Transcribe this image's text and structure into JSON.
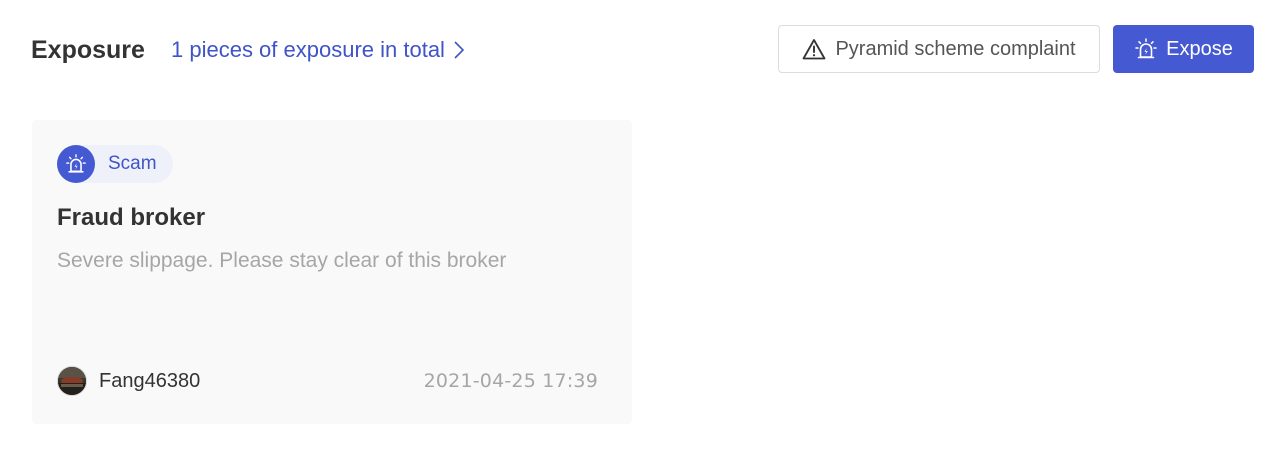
{
  "header": {
    "title": "Exposure",
    "total_link": "1 pieces of exposure in total",
    "total_link_icon": "chevron-right-icon",
    "complaint_button": {
      "label": "Pyramid scheme complaint",
      "icon": "warning-triangle-icon"
    },
    "expose_button": {
      "label": "Expose",
      "icon": "alarm-siren-icon"
    }
  },
  "exposures": [
    {
      "tag": {
        "label": "Scam",
        "icon": "alarm-siren-icon"
      },
      "title": "Fraud broker",
      "description": "Severe slippage. Please stay clear of this broker",
      "author": {
        "name": "Fang46380",
        "avatar": "user-avatar"
      },
      "timestamp": "2021-04-25 17:39"
    }
  ],
  "colors": {
    "accent": "#4559d3",
    "link": "#3f54c8",
    "tag_background": "#eef0fa",
    "card_background": "#f9f9f9",
    "muted_text": "#a6a6a6"
  }
}
